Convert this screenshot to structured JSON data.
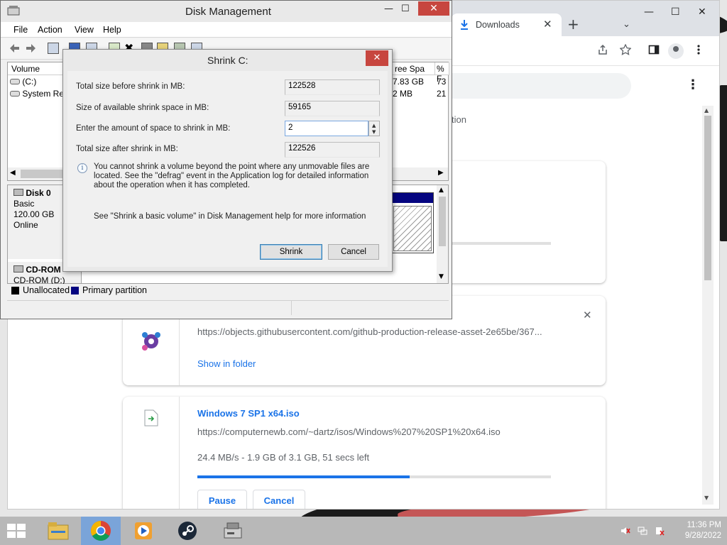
{
  "colors": {
    "accent_blue": "#1a73e8",
    "primary_partition": "#050580",
    "close_red": "#c7463f"
  },
  "chrome": {
    "tab_title": "Downloads",
    "tab_close": "✕",
    "new_tab": "+",
    "tab_dropdown": "⌄",
    "win_min": "—",
    "win_max": "☐",
    "win_close": "✕",
    "kebab": "⋮",
    "partial_text": "tion",
    "downloads": [
      {
        "url": "https://objects.githubusercontent.com/github-production-release-asset-2e65be/367...",
        "show_in_folder": "Show in folder",
        "close": "✕"
      },
      {
        "name": "Windows 7 SP1 x64.iso",
        "url": "https://computernewb.com/~dartz/isos/Windows%207%20SP1%20x64.iso",
        "status": "24.4 MB/s - 1.9 GB of 3.1 GB, 51 secs left",
        "progress": 0.6,
        "pause": "Pause",
        "cancel": "Cancel"
      }
    ]
  },
  "disk_mgmt": {
    "title": "Disk Management",
    "min": "—",
    "max": "☐",
    "close": "✕",
    "menu": [
      "File",
      "Action",
      "View",
      "Help"
    ],
    "columns": {
      "volume": "Volume",
      "free_space": "ree Spa",
      "pct": "% F"
    },
    "volumes": [
      {
        "name": "(C:)",
        "free": "7.83 GB",
        "pct": "73"
      },
      {
        "name": "System Res",
        "free": "2 MB",
        "pct": "21"
      }
    ],
    "disks": [
      {
        "name": "Disk 0",
        "type": "Basic",
        "size": "120.00 GB",
        "status": "Online"
      },
      {
        "name": "CD-ROM",
        "type": "CD-ROM (D:)"
      }
    ],
    "legend": {
      "unallocated": "Unallocated",
      "primary": "Primary partition"
    }
  },
  "shrink": {
    "title": "Shrink C:",
    "close": "✕",
    "total_before_label": "Total size before shrink in MB:",
    "total_before": "122528",
    "available_label": "Size of available shrink space in MB:",
    "available": "59165",
    "amount_label": "Enter the amount of space to shrink in MB:",
    "amount": "2",
    "total_after_label": "Total size after shrink in MB:",
    "total_after": "122526",
    "info_text": "You cannot shrink a volume beyond the point where any unmovable files are located. See the \"defrag\" event in the Application log for detailed information about the operation when it has completed.",
    "help_text": "See \"Shrink a basic volume\" in Disk Management help for more information",
    "shrink_button": "Shrink",
    "cancel_button": "Cancel"
  },
  "taskbar": {
    "time": "11:36 PM",
    "date": "9/28/2022"
  }
}
